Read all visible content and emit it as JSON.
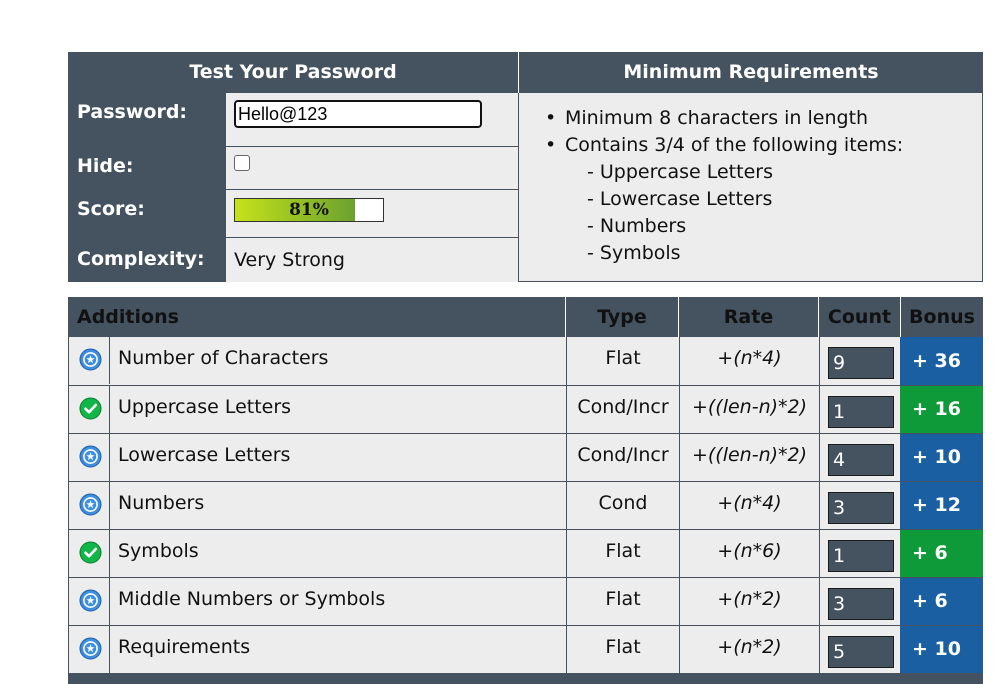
{
  "test_panel": {
    "title": "Test Your Password",
    "password_label": "Password:",
    "password_value": "Hello@123",
    "hide_label": "Hide:",
    "hide_checked": false,
    "score_label": "Score:",
    "score_text": "81%",
    "score_fraction": 0.81,
    "complexity_label": "Complexity:",
    "complexity_value": "Very Strong"
  },
  "requirements_panel": {
    "title": "Minimum Requirements",
    "items": [
      "Minimum 8 characters in length",
      "Contains 3/4 of the following items:"
    ],
    "sub_items": [
      "- Uppercase Letters",
      "- Lowercase Letters",
      "- Numbers",
      "- Symbols"
    ]
  },
  "additions_table": {
    "headers": {
      "name": "Additions",
      "type": "Type",
      "rate": "Rate",
      "count": "Count",
      "bonus": "Bonus"
    },
    "rows": [
      {
        "name": "Number of Characters",
        "type": "Flat",
        "rate": "+(n*4)",
        "count": "9",
        "bonus": "+ 36",
        "icon": "info-star-icon",
        "status": "neutral"
      },
      {
        "name": "Uppercase Letters",
        "type": "Cond/Incr",
        "rate": "+((len-n)*2)",
        "count": "1",
        "bonus": "+ 16",
        "icon": "check-icon",
        "status": "pass"
      },
      {
        "name": "Lowercase Letters",
        "type": "Cond/Incr",
        "rate": "+((len-n)*2)",
        "count": "4",
        "bonus": "+ 10",
        "icon": "info-star-icon",
        "status": "neutral"
      },
      {
        "name": "Numbers",
        "type": "Cond",
        "rate": "+(n*4)",
        "count": "3",
        "bonus": "+ 12",
        "icon": "info-star-icon",
        "status": "neutral"
      },
      {
        "name": "Symbols",
        "type": "Flat",
        "rate": "+(n*6)",
        "count": "1",
        "bonus": "+ 6",
        "icon": "check-icon",
        "status": "pass"
      },
      {
        "name": "Middle Numbers or Symbols",
        "type": "Flat",
        "rate": "+(n*2)",
        "count": "3",
        "bonus": "+ 6",
        "icon": "info-star-icon",
        "status": "neutral"
      },
      {
        "name": "Requirements",
        "type": "Flat",
        "rate": "+(n*2)",
        "count": "5",
        "bonus": "+ 10",
        "icon": "info-star-icon",
        "status": "neutral"
      }
    ]
  },
  "colors": {
    "header_bg": "#44535f",
    "cell_bg": "#ededed",
    "bonus_neutral": "#1b5fa3",
    "bonus_pass": "#0e9a38",
    "score_gradient_start": "#c6e21a",
    "score_gradient_end": "#6aa22e"
  }
}
